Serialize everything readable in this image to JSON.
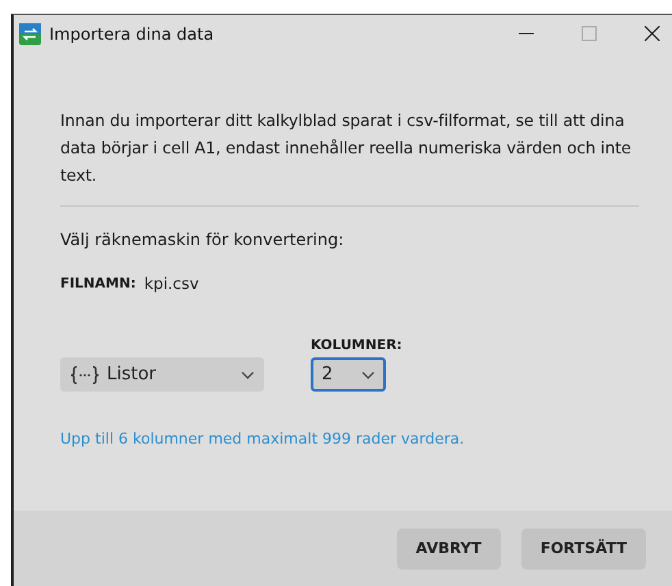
{
  "window": {
    "title": "Importera dina data"
  },
  "intro": "Innan du importerar ditt kalkylblad sparat i csv-filformat, se till att dina data börjar i cell A1, endast innehåller reella numeriska värden och inte text.",
  "prompt": "Välj räknemaskin för konvertering:",
  "file": {
    "label": "FILNAMN:",
    "value": "kpi.csv"
  },
  "calculator_select": {
    "value": "Listor",
    "focused": false
  },
  "columns_select": {
    "label": "KOLUMNER:",
    "value": "2",
    "focused": true
  },
  "hint": "Upp till 6 kolumner med maximalt 999 rader vardera.",
  "buttons": [
    {
      "label": "AVBRYT"
    },
    {
      "label": "FORTSÄTT"
    }
  ]
}
